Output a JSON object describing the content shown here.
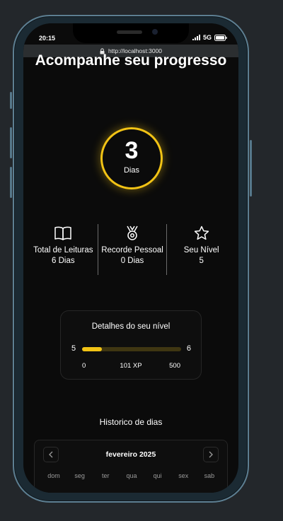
{
  "status_bar": {
    "time": "20:15",
    "network": "5G"
  },
  "browser": {
    "url": "http://localhost:3000"
  },
  "page": {
    "title": "Acompanhe seu progresso"
  },
  "streak": {
    "value": "3",
    "unit": "Dias"
  },
  "stats": [
    {
      "icon": "book-icon",
      "label": "Total de Leituras",
      "value": "6 Dias"
    },
    {
      "icon": "medal-icon",
      "label": "Recorde Pessoal",
      "value": "0 Dias"
    },
    {
      "icon": "star-icon",
      "label": "Seu Nível",
      "value": "5"
    }
  ],
  "level": {
    "title": "Detalhes do seu nível",
    "current_level": "5",
    "next_level": "6",
    "xp_min": "0",
    "xp_current": "101 XP",
    "xp_max": "500",
    "progress_fraction": 0.2,
    "accent_color": "#f2c315"
  },
  "history": {
    "title": "Historico de dias",
    "month": "fevereiro 2025",
    "prev_icon": "chevron-left-icon",
    "next_icon": "chevron-right-icon",
    "weekdays": [
      "dom",
      "seg",
      "ter",
      "qua",
      "qui",
      "sex",
      "sab"
    ]
  }
}
